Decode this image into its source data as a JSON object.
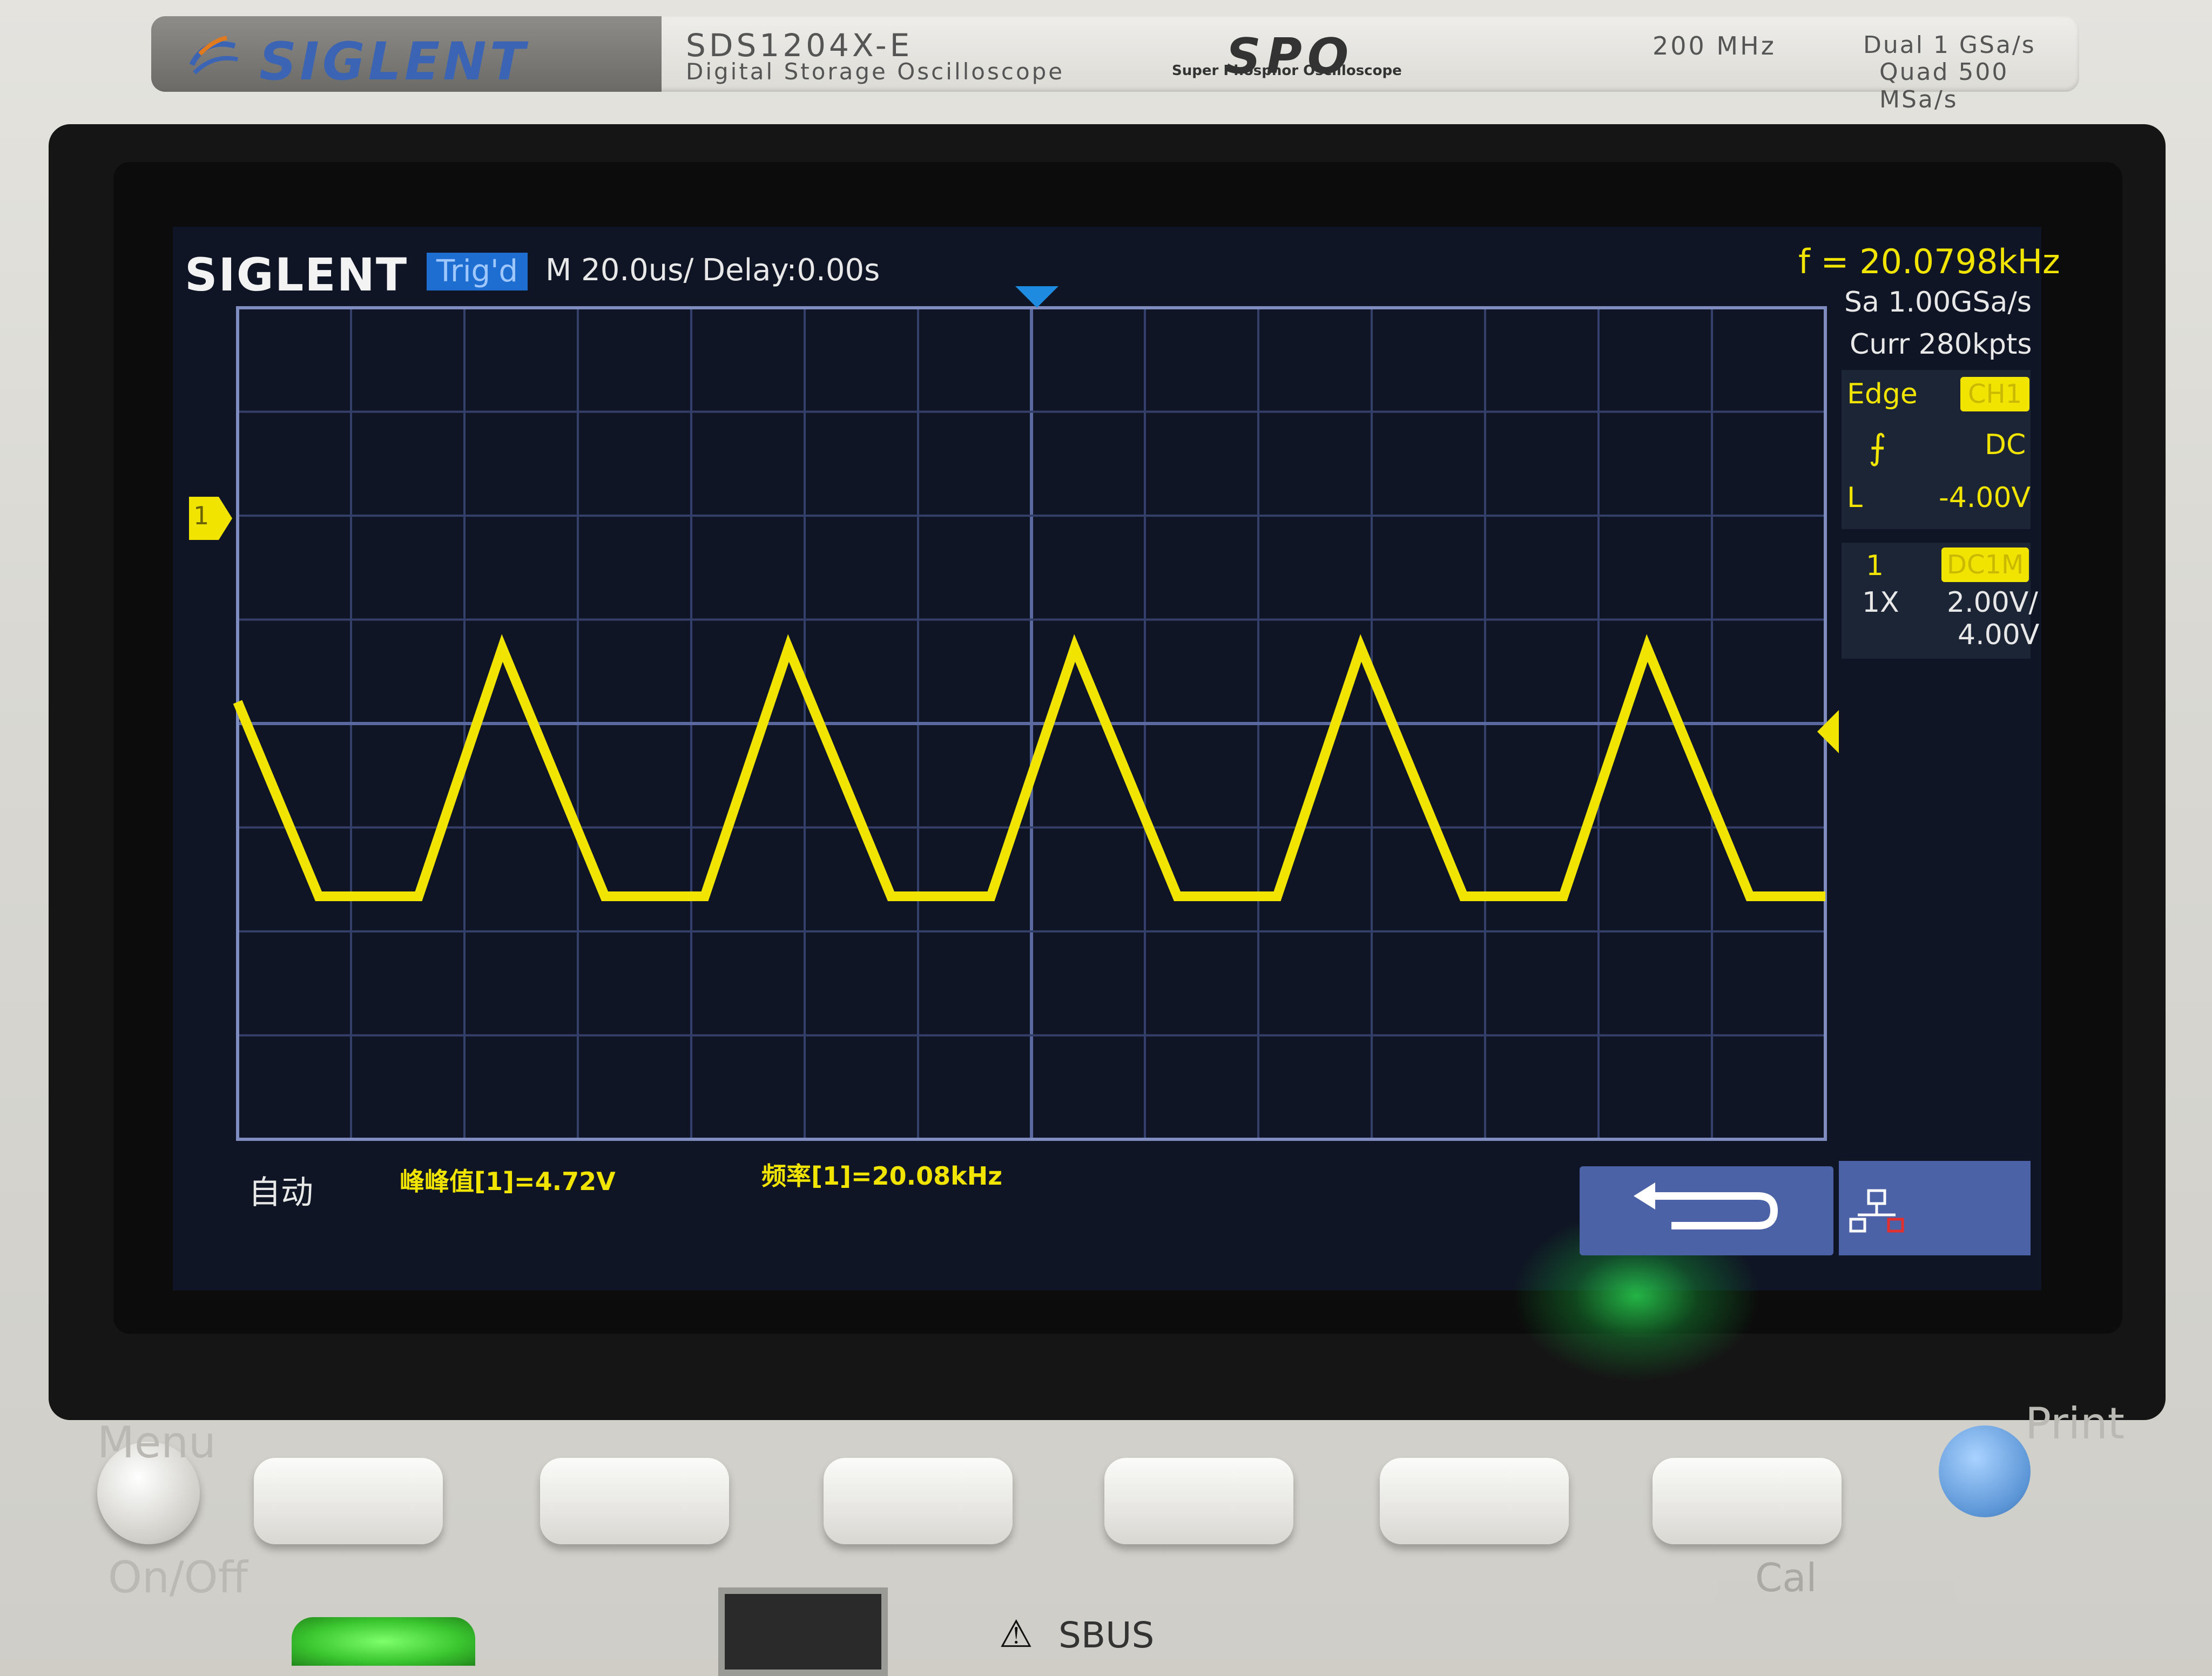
{
  "instrument": {
    "brand": "SIGLENT",
    "model": "SDS1204X-E",
    "description": "Digital Storage Oscilloscope",
    "series_logo": "SPO",
    "series_subtitle": "Super Phosphor Oscilloscope",
    "bandwidth": "200 MHz",
    "rate_dual": "Dual  1 GSa/s",
    "rate_quad": "Quad  500 MSa/s"
  },
  "screen": {
    "logo": "SIGLENT",
    "trigger_status": "Trig'd",
    "timebase": "M 20.0us/",
    "delay": "Delay:0.00s",
    "frequency_counter": "f = 20.0798kHz",
    "sample_rate": "Sa 1.00GSa/s",
    "memory_depth": "Curr 280kpts",
    "trigger": {
      "type": "Edge",
      "source": "CH1",
      "slope_icon": "rising-edge-icon",
      "coupling": "DC",
      "level_label": "L",
      "level": "-4.00V"
    },
    "channel1": {
      "number": "1",
      "coupling": "DC1M",
      "probe": "1X",
      "scale": "2.00V/",
      "offset": "4.00V",
      "marker": "1",
      "color": "#f0e400"
    },
    "acquisition_mode": "自动",
    "measurements": [
      "峰峰值[1]=4.72V",
      "频率[1]=20.08kHz"
    ],
    "buttons": {
      "back_icon": "return-arrow-icon",
      "network_icon": "network-icon"
    },
    "waveform": {
      "shape": "trapezoid-triangle",
      "frequency_khz": 20.08,
      "vpp_v": 4.72,
      "color": "#f0e400"
    }
  },
  "panel": {
    "menu_label": "Menu",
    "power_label": "On/Off",
    "print_label": "Print",
    "cal_label": "Cal",
    "sbus_label": "SBUS",
    "softkey_count": 6
  }
}
